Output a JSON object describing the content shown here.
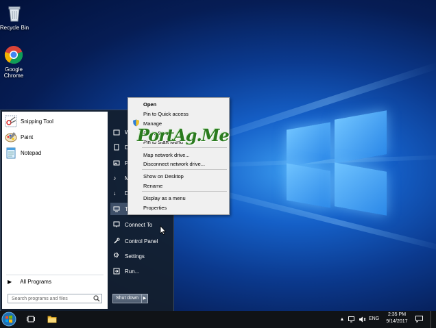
{
  "desktop": {
    "icons": [
      {
        "label": "Recycle Bin",
        "icon": "recycle-bin-icon"
      },
      {
        "label": "Google\nChrome",
        "icon": "chrome-icon"
      }
    ]
  },
  "start_menu": {
    "programs": [
      {
        "label": "Snipping Tool",
        "icon": "snipping-tool-icon"
      },
      {
        "label": "Paint",
        "icon": "paint-icon"
      },
      {
        "label": "Notepad",
        "icon": "notepad-icon"
      }
    ],
    "all_programs": "All Programs",
    "search_placeholder": "Search programs and files",
    "right_items": [
      {
        "label": "W",
        "icon": "user-folder-icon"
      },
      {
        "label": "D",
        "icon": "documents-icon"
      },
      {
        "label": "P",
        "icon": "pictures-icon"
      },
      {
        "label": "M",
        "icon": "music-icon"
      },
      {
        "label": "D",
        "icon": "downloads-icon"
      },
      {
        "label": "T",
        "icon": "this-pc-icon"
      },
      {
        "label": "Connect To",
        "icon": "connect-to-icon"
      },
      {
        "label": "Control Panel",
        "icon": "control-panel-icon"
      },
      {
        "label": "Settings",
        "icon": "settings-icon"
      },
      {
        "label": "Run...",
        "icon": "run-icon"
      }
    ],
    "shutdown_label": "Shut down"
  },
  "context_menu": {
    "items": [
      {
        "label": "Open",
        "bold": true
      },
      {
        "label": "Pin to Quick access"
      },
      {
        "label": "Manage",
        "icon": "shield-icon"
      },
      {
        "label": "Pin to Start"
      },
      {
        "label": "Pin to Start Menu"
      },
      {
        "label": "Map network drive..."
      },
      {
        "label": "Disconnect network drive..."
      },
      {
        "label": "Show on Desktop"
      },
      {
        "label": "Rename"
      },
      {
        "label": "Display as a menu"
      },
      {
        "label": "Properties"
      }
    ],
    "watermark": "PortAg.Me"
  },
  "taskbar": {
    "tray": {
      "language": "ENG",
      "time": "2:35 PM",
      "date": "9/14/2017"
    }
  }
}
